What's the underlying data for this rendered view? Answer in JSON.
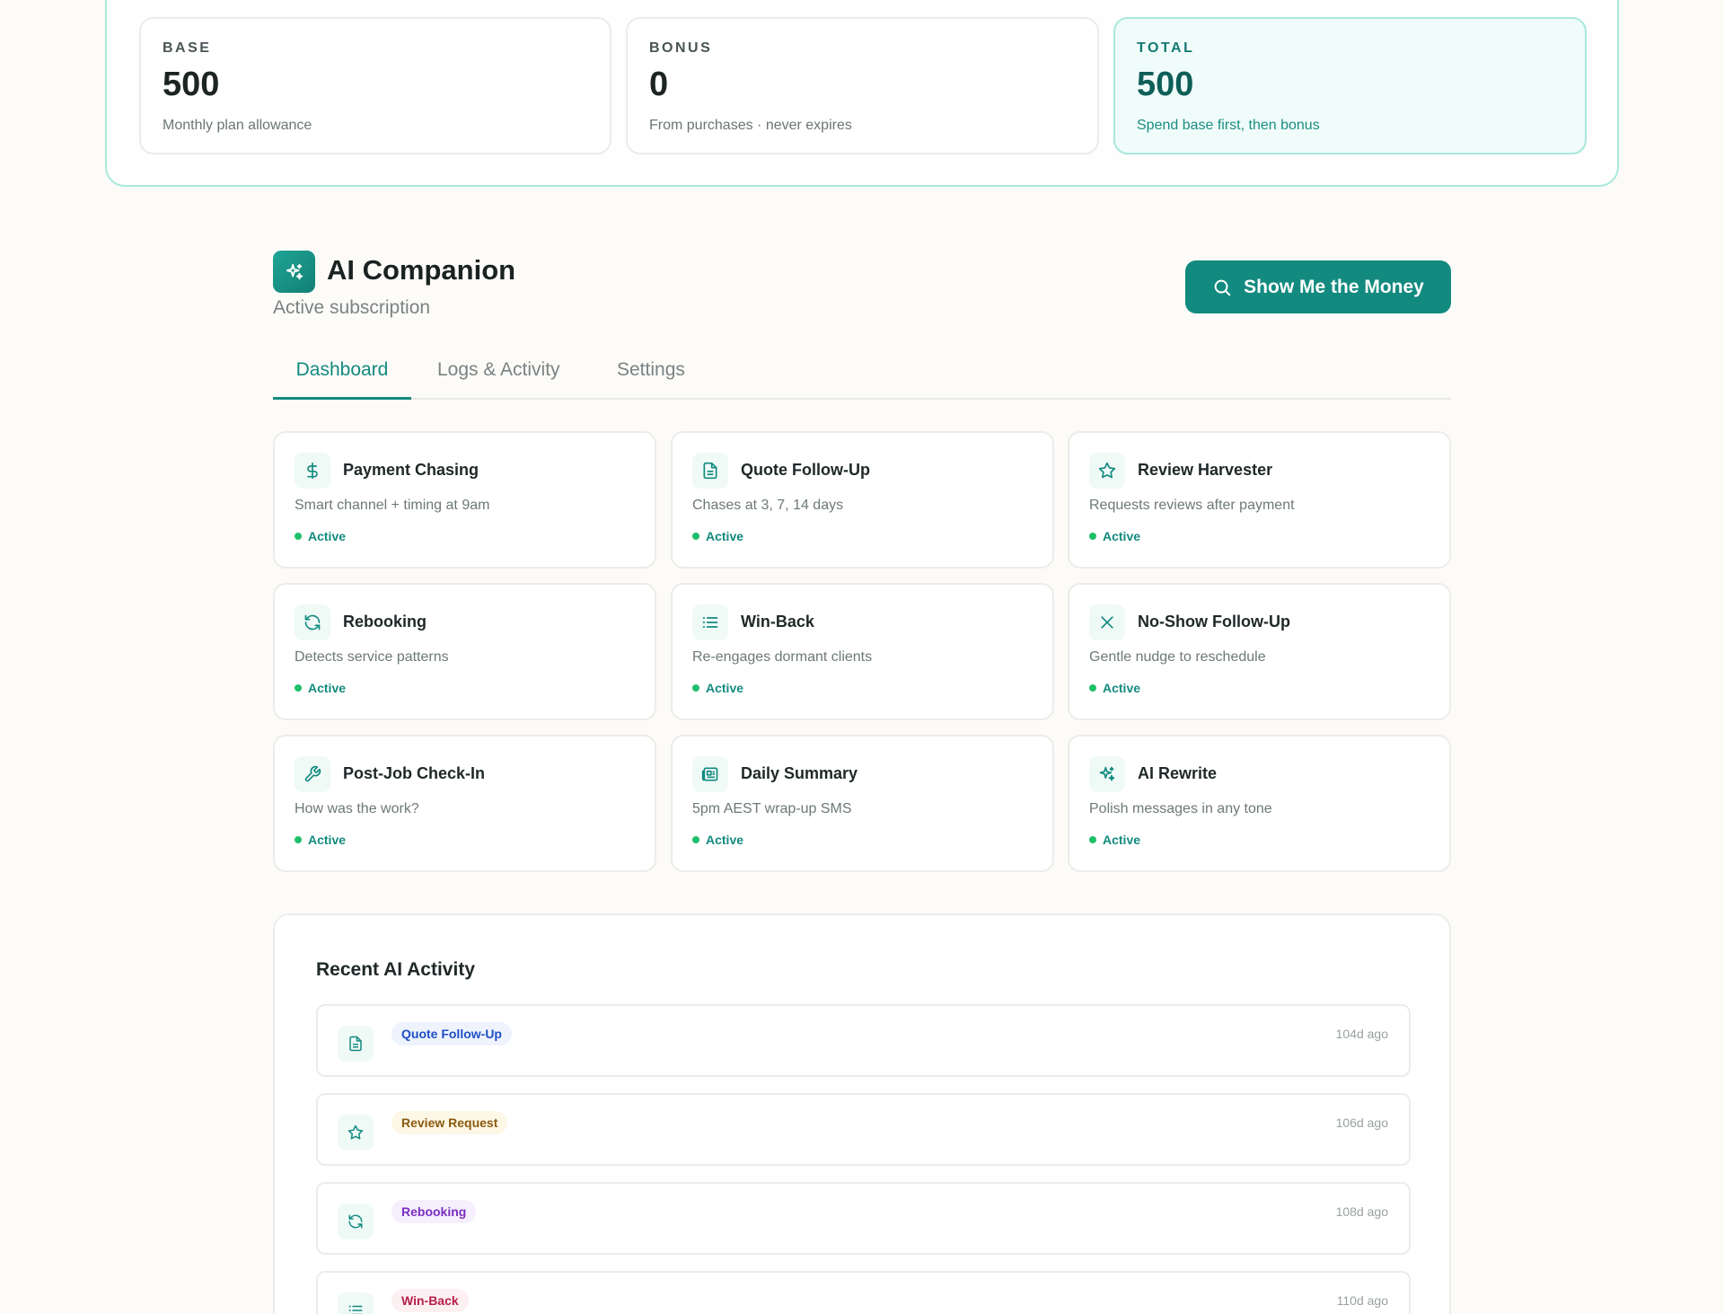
{
  "credits": {
    "base": {
      "label": "BASE",
      "value": "500",
      "sub": "Monthly plan allowance"
    },
    "bonus": {
      "label": "BONUS",
      "value": "0",
      "sub": "From purchases · never expires"
    },
    "total": {
      "label": "TOTAL",
      "value": "500",
      "sub": "Spend base first, then bonus"
    }
  },
  "header": {
    "title": "AI Companion",
    "subtitle": "Active subscription",
    "money_button": "Show Me the Money",
    "logo_icon": "sparkles-icon",
    "button_icon": "search-icon"
  },
  "tabs": [
    {
      "label": "Dashboard",
      "active": true
    },
    {
      "label": "Logs & Activity",
      "active": false
    },
    {
      "label": "Settings",
      "active": false
    }
  ],
  "features": [
    {
      "title": "Payment Chasing",
      "desc": "Smart channel + timing at 9am",
      "status": "Active",
      "icon": "dollar-icon"
    },
    {
      "title": "Quote Follow-Up",
      "desc": "Chases at 3, 7, 14 days",
      "status": "Active",
      "icon": "document-icon"
    },
    {
      "title": "Review Harvester",
      "desc": "Requests reviews after payment",
      "status": "Active",
      "icon": "star-icon"
    },
    {
      "title": "Rebooking",
      "desc": "Detects service patterns",
      "status": "Active",
      "icon": "refresh-icon"
    },
    {
      "title": "Win-Back",
      "desc": "Re-engages dormant clients",
      "status": "Active",
      "icon": "list-icon"
    },
    {
      "title": "No-Show Follow-Up",
      "desc": "Gentle nudge to reschedule",
      "status": "Active",
      "icon": "x-icon"
    },
    {
      "title": "Post-Job Check-In",
      "desc": "How was the work?",
      "status": "Active",
      "icon": "wrench-icon"
    },
    {
      "title": "Daily Summary",
      "desc": "5pm AEST wrap-up SMS",
      "status": "Active",
      "icon": "newspaper-icon"
    },
    {
      "title": "AI Rewrite",
      "desc": "Polish messages in any tone",
      "status": "Active",
      "icon": "sparkles-icon"
    }
  ],
  "activity": {
    "title": "Recent AI Activity",
    "items": [
      {
        "badge": "Quote Follow-Up",
        "time": "104d ago",
        "icon": "document-icon",
        "badge_bg": "#eef3fd",
        "badge_fg": "#1f4fc4"
      },
      {
        "badge": "Review Request",
        "time": "106d ago",
        "icon": "star-icon",
        "badge_bg": "#fdf7e6",
        "badge_fg": "#8a5a10"
      },
      {
        "badge": "Rebooking",
        "time": "108d ago",
        "icon": "refresh-icon",
        "badge_bg": "#f6effd",
        "badge_fg": "#7a2fc0"
      },
      {
        "badge": "Win-Back",
        "time": "110d ago",
        "icon": "list-icon",
        "badge_bg": "#fdf0f3",
        "badge_fg": "#b4204a"
      }
    ]
  },
  "colors": {
    "accent": "#138a7f",
    "status_dot": "#1fbf6a",
    "accent_border": "#a9e8dc"
  }
}
